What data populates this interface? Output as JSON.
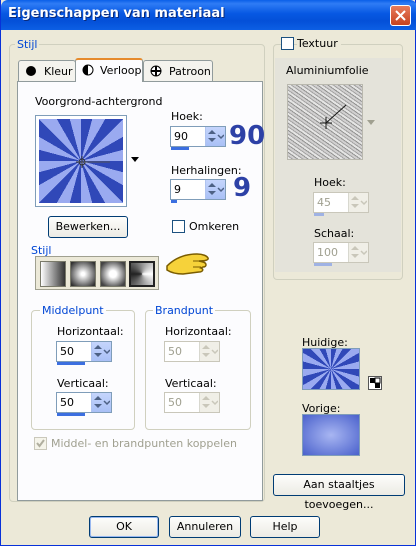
{
  "window": {
    "title": "Eigenschappen van materiaal"
  },
  "stijl_group": {
    "label": "Stijl"
  },
  "tabs": [
    {
      "label": "Kleur",
      "icon": "circle-icon"
    },
    {
      "label": "Verloop",
      "icon": "half-circle-icon"
    },
    {
      "label": "Patroon",
      "icon": "pattern-icon"
    }
  ],
  "gradient": {
    "name": "Voorgrond-achtergrond"
  },
  "angle": {
    "label": "Hoek:",
    "value": "90",
    "big": "90"
  },
  "repeats": {
    "label": "Herhalingen:",
    "value": "9",
    "big": "9"
  },
  "edit_button": "Bewerken...",
  "invert": {
    "label": "Omkeren"
  },
  "style": {
    "label": "Stijl"
  },
  "center_point": {
    "label": "Middelpunt",
    "horizontal_label": "Horizontaal:",
    "horizontal_value": "50",
    "vertical_label": "Verticaal:",
    "vertical_value": "50"
  },
  "focal_point": {
    "label": "Brandpunt",
    "horizontal_label": "Horizontaal:",
    "horizontal_value": "50",
    "vertical_label": "Verticaal:",
    "vertical_value": "50"
  },
  "link_points": {
    "label": "Middel- en brandpunten koppelen"
  },
  "texture": {
    "label": "Textuur",
    "name": "Aluminiumfolie",
    "angle_label": "Hoek:",
    "angle_value": "45",
    "scale_label": "Schaal:",
    "scale_value": "100"
  },
  "current": {
    "label": "Huidige:"
  },
  "previous": {
    "label": "Vorige:"
  },
  "add_swatch_button": "Aan staaltjes toevoegen...",
  "buttons": {
    "ok": "OK",
    "cancel": "Annuleren",
    "help": "Help"
  },
  "colors": {
    "accent": "#0046d5",
    "title_bar": "#0758e3",
    "big_number": "#2d41a6"
  }
}
